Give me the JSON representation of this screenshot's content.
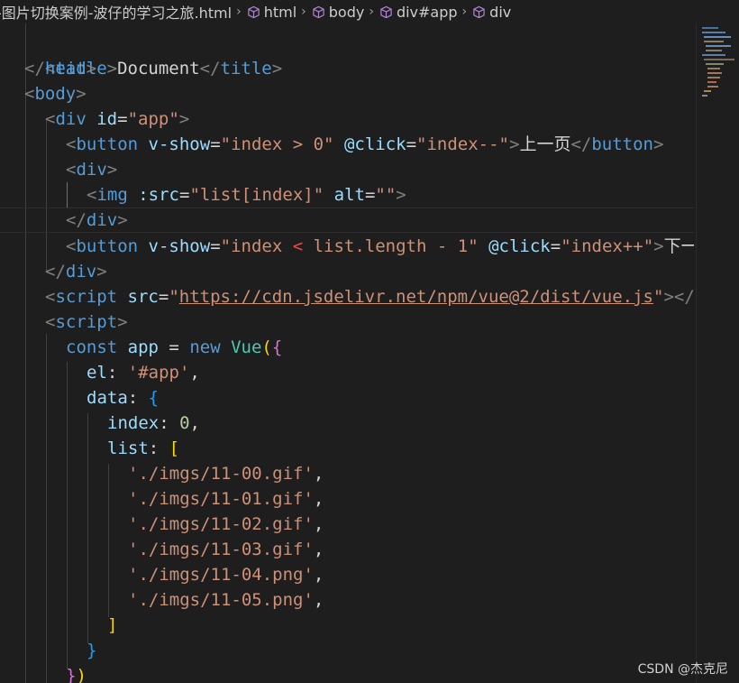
{
  "breadcrumb": {
    "file": "-图片切换案例-波仔的学习之旅.html",
    "items": [
      "html",
      "body",
      "div#app",
      "div"
    ]
  },
  "code": {
    "title_line": {
      "t1": "<",
      "tag": "title",
      "t2": ">",
      "text": "Document",
      "t3": "</",
      "tag2": "title",
      "t4": ">"
    },
    "head_close": "head",
    "body_open": "body",
    "div_open": {
      "tag": "div",
      "attr": "id",
      "value": "\"app\""
    },
    "btn_prev": {
      "tag": "button",
      "a1": "v-show",
      "v1": "\"index > 0\"",
      "a2": "@click",
      "v2": "\"index--\"",
      "text": "上一页",
      "close": "button"
    },
    "inner_div_open": "div",
    "img_line": {
      "tag": "img",
      "a1": ":src",
      "v1": "\"list[index]\"",
      "a2": "alt",
      "v2": "\"\""
    },
    "inner_div_close": "div",
    "btn_next": {
      "tag": "button",
      "a1": "v-show",
      "v1a": "\"index ",
      "v1lt": "<",
      "v1b": " list.length - 1\"",
      "a2": "@click",
      "v2": "\"index++\"",
      "text": "下一"
    },
    "div_close": "div",
    "script_src": {
      "tag": "script",
      "attr": "src",
      "url": "https://cdn.jsdelivr.net/npm/vue@2/dist/vue.js",
      "tail": "</s"
    },
    "script_open": "script",
    "js": {
      "const": "const",
      "name": "app",
      "eq": " = ",
      "new": "new",
      "cls": "Vue",
      "el_key": "el",
      "el_val": "'#app'",
      "data_key": "data",
      "index_key": "index",
      "index_val": "0",
      "list_key": "list",
      "items": [
        "'./imgs/11-00.gif'",
        "'./imgs/11-01.gif'",
        "'./imgs/11-02.gif'",
        "'./imgs/11-03.gif'",
        "'./imgs/11-04.png'",
        "'./imgs/11-05.png'"
      ]
    }
  },
  "watermark": "CSDN @杰克尼",
  "colors": {
    "background": "#1e1e1e",
    "tag": "#569cd6",
    "attribute": "#9cdcfe",
    "string": "#ce9178",
    "bracket_gold": "#ffd700",
    "bracket_purple": "#da70d6",
    "bracket_blue": "#179fff"
  }
}
